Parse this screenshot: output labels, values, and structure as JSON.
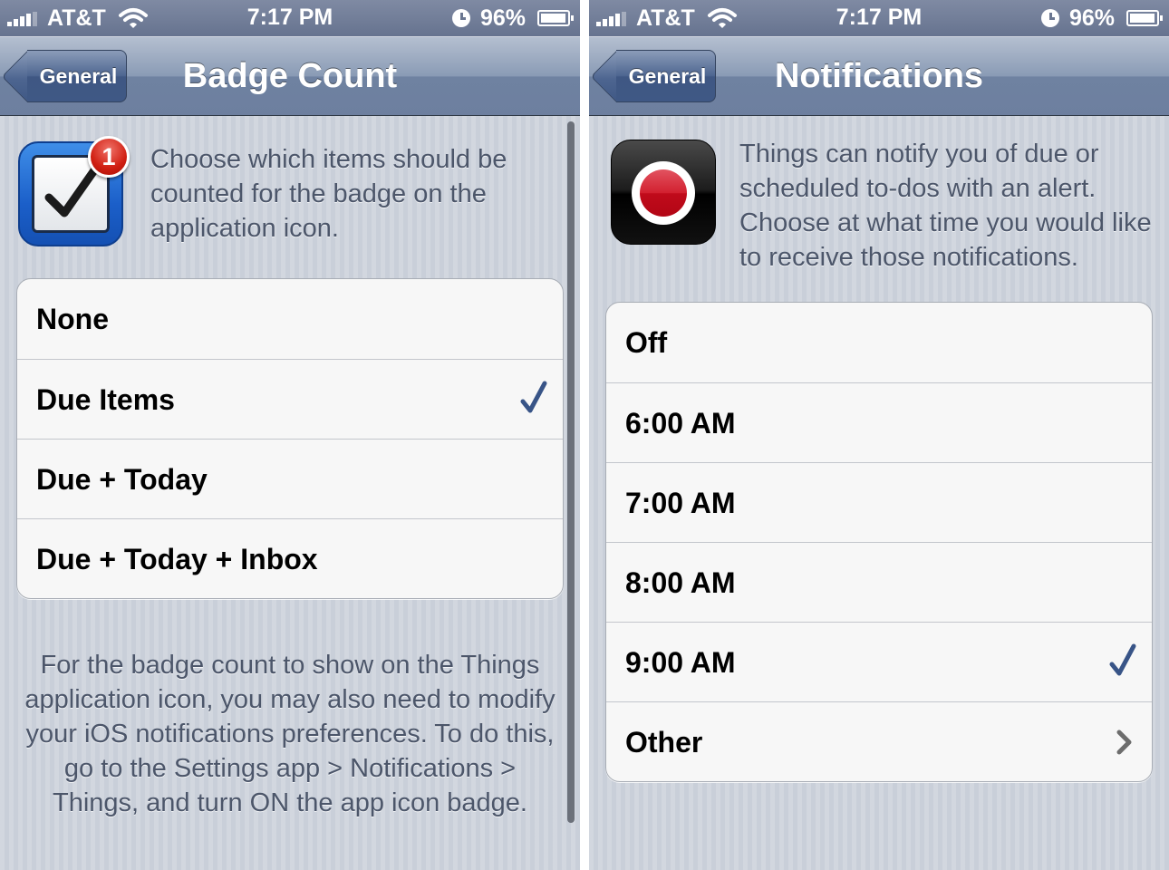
{
  "left_screen": {
    "status": {
      "carrier": "AT&T",
      "time": "7:17 PM",
      "battery": "96%"
    },
    "nav": {
      "back_label": "General",
      "title": "Badge Count"
    },
    "intro": "Choose which items should be counted for the badge on the application icon.",
    "app_badge": "1",
    "options": [
      {
        "label": "None",
        "selected": false
      },
      {
        "label": "Due Items",
        "selected": true
      },
      {
        "label": "Due + Today",
        "selected": false
      },
      {
        "label": "Due + Today + Inbox",
        "selected": false
      }
    ],
    "footer": "For the badge count to show on the Things application icon, you may also need to modify your iOS notifications preferences. To do this, go to the Settings app > Notifications > Things, and turn ON the app icon badge."
  },
  "right_screen": {
    "status": {
      "carrier": "AT&T",
      "time": "7:17 PM",
      "battery": "96%"
    },
    "nav": {
      "back_label": "General",
      "title": "Notifications"
    },
    "intro": "Things can notify you of due or scheduled to-dos with an alert. Choose at what time you would like to receive those notifications.",
    "options": [
      {
        "label": "Off",
        "selected": false
      },
      {
        "label": "6:00 AM",
        "selected": false
      },
      {
        "label": "7:00 AM",
        "selected": false
      },
      {
        "label": "8:00 AM",
        "selected": false
      },
      {
        "label": "9:00 AM",
        "selected": true
      },
      {
        "label": "Other",
        "disclosure": true
      }
    ]
  },
  "colors": {
    "nav_bar": "#6d7f9f",
    "checkmark": "#385487",
    "badge_red": "#d01f12",
    "background": "#c9cfd9"
  },
  "icons": [
    "signal-bars-icon",
    "wifi-icon",
    "clock-icon",
    "battery-icon",
    "checkmark-icon",
    "chevron-right-icon"
  ]
}
